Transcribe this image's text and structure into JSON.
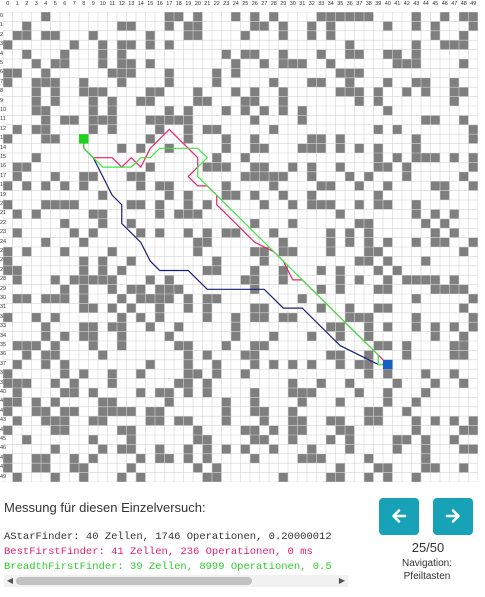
{
  "grid": {
    "cols": 50,
    "rows": 50,
    "wall_color": "#7f7f7f",
    "line_color": "#d4d4d4",
    "start": {
      "col": 8,
      "row": 13,
      "color": "#1fd01f"
    },
    "end": {
      "col": 40,
      "row": 37,
      "color": "#1a5fc8"
    },
    "walls_seed": 73,
    "walls_density": 0.3
  },
  "col_labels": [
    "0",
    "1",
    "2",
    "3",
    "4",
    "5",
    "6",
    "7",
    "8",
    "9",
    "10",
    "11",
    "12",
    "13",
    "14",
    "15",
    "16",
    "17",
    "18",
    "19",
    "20",
    "21",
    "22",
    "23",
    "24",
    "25",
    "26",
    "27",
    "28",
    "29",
    "30",
    "31",
    "32",
    "33",
    "34",
    "35",
    "36",
    "37",
    "38",
    "39",
    "40",
    "41",
    "42",
    "43",
    "44",
    "45",
    "46",
    "47",
    "48",
    "49"
  ],
  "row_labels": [
    "0",
    "1",
    "2",
    "3",
    "4",
    "5",
    "6",
    "7",
    "8",
    "9",
    "10",
    "11",
    "12",
    "13",
    "14",
    "15",
    "16",
    "17",
    "18",
    "19",
    "20",
    "21",
    "22",
    "23",
    "24",
    "25",
    "26",
    "27",
    "28",
    "29",
    "30",
    "31",
    "32",
    "33",
    "34",
    "35",
    "36",
    "37",
    "38",
    "39",
    "40",
    "41",
    "42",
    "43",
    "44",
    "45",
    "46",
    "47",
    "48",
    "49"
  ],
  "paths": [
    {
      "finder": "AStarFinder",
      "color": "#1c1f7a",
      "points": [
        [
          8,
          13
        ],
        [
          8,
          14
        ],
        [
          9,
          15
        ],
        [
          10,
          17
        ],
        [
          11,
          19
        ],
        [
          12,
          20
        ],
        [
          12,
          22
        ],
        [
          13,
          23
        ],
        [
          14,
          24
        ],
        [
          15,
          26
        ],
        [
          16,
          27
        ],
        [
          19,
          27
        ],
        [
          20,
          28
        ],
        [
          21,
          29
        ],
        [
          27,
          29
        ],
        [
          28,
          30
        ],
        [
          29,
          31
        ],
        [
          31,
          31
        ],
        [
          32,
          32
        ],
        [
          33,
          33
        ],
        [
          34,
          34
        ],
        [
          35,
          35
        ],
        [
          37,
          36
        ],
        [
          39,
          37
        ],
        [
          40,
          37
        ]
      ]
    },
    {
      "finder": "BestFirstFinder",
      "color": "#e8206f",
      "points": [
        [
          8,
          13
        ],
        [
          8,
          14
        ],
        [
          9,
          15
        ],
        [
          11,
          15
        ],
        [
          12,
          16
        ],
        [
          13,
          15
        ],
        [
          14,
          16
        ],
        [
          15,
          14
        ],
        [
          16,
          13
        ],
        [
          17,
          12
        ],
        [
          18,
          13
        ],
        [
          19,
          14
        ],
        [
          20,
          15
        ],
        [
          20,
          16
        ],
        [
          19,
          17
        ],
        [
          20,
          18
        ],
        [
          21,
          18
        ],
        [
          22,
          19
        ],
        [
          22,
          20
        ],
        [
          23,
          21
        ],
        [
          24,
          22
        ],
        [
          25,
          23
        ],
        [
          26,
          24
        ],
        [
          28,
          25
        ],
        [
          29,
          26
        ],
        [
          30,
          28
        ],
        [
          31,
          28
        ],
        [
          32,
          29
        ],
        [
          33,
          30
        ],
        [
          34,
          31
        ],
        [
          35,
          32
        ],
        [
          36,
          33
        ],
        [
          37,
          34
        ],
        [
          38,
          35
        ],
        [
          39,
          36
        ],
        [
          40,
          37
        ]
      ]
    },
    {
      "finder": "BreadthFirstFinder",
      "color": "#3ce83c",
      "points": [
        [
          8,
          13
        ],
        [
          8,
          14
        ],
        [
          9,
          15
        ],
        [
          10,
          16
        ],
        [
          13,
          16
        ],
        [
          14,
          15
        ],
        [
          15,
          15
        ],
        [
          16,
          14
        ],
        [
          20,
          14
        ],
        [
          21,
          15
        ],
        [
          20,
          16
        ],
        [
          20,
          17
        ],
        [
          21,
          18
        ],
        [
          22,
          19
        ],
        [
          23,
          20
        ],
        [
          24,
          21
        ],
        [
          25,
          22
        ],
        [
          26,
          23
        ],
        [
          27,
          24
        ],
        [
          28,
          25
        ],
        [
          29,
          26
        ],
        [
          30,
          27
        ],
        [
          31,
          28
        ],
        [
          32,
          29
        ],
        [
          33,
          30
        ],
        [
          34,
          31
        ],
        [
          35,
          32
        ],
        [
          36,
          33
        ],
        [
          37,
          34
        ],
        [
          38,
          35
        ],
        [
          39,
          36
        ],
        [
          39,
          37
        ],
        [
          40,
          37
        ]
      ]
    }
  ],
  "measure_title": "Messung für diesen Einzelversuch:",
  "results": [
    {
      "text": "AStarFinder: 40 Zellen, 1746 Operationen, 0.20000012",
      "color": "#333333"
    },
    {
      "text": "BestFirstFinder: 41 Zellen, 236 Operationen, 0 ms",
      "color": "#e8206f"
    },
    {
      "text": "BreadthFirstFinder: 39 Zellen, 8999 Operationen, 0.5",
      "color": "#2ecc2e"
    }
  ],
  "navigation": {
    "counter": "25/50",
    "hint_line1": "Navigation:",
    "hint_line2": "Pfeiltasten",
    "prev_icon": "arrow-left-icon",
    "next_icon": "arrow-right-icon",
    "button_color": "#17a2b8"
  }
}
